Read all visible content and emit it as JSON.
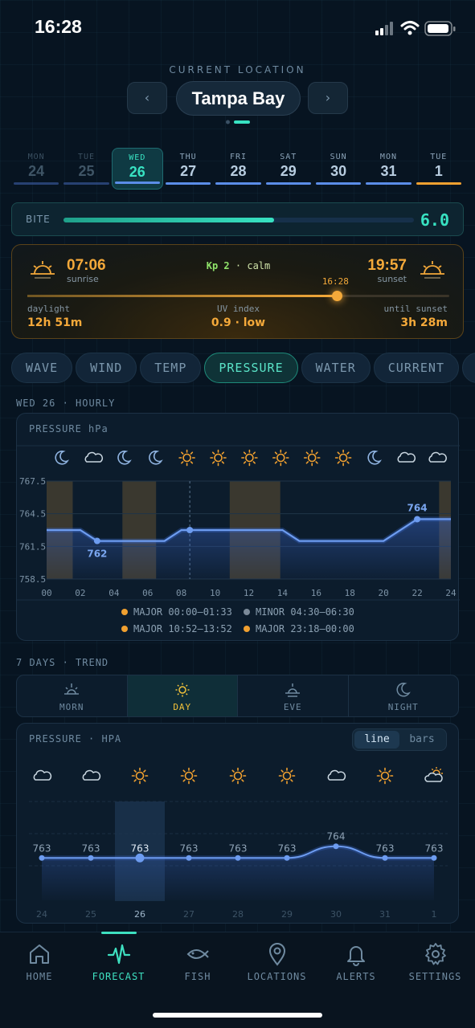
{
  "status_bar": {
    "time": "16:28"
  },
  "location": {
    "label": "CURRENT LOCATION",
    "name": "Tampa Bay",
    "prev": "‹",
    "next": "›"
  },
  "days": [
    {
      "name": "MON",
      "date": "24",
      "state": "past",
      "bar_color": "#3d5fa8"
    },
    {
      "name": "TUE",
      "date": "25",
      "state": "past",
      "bar_color": "#3d5fa8"
    },
    {
      "name": "WED",
      "date": "26",
      "state": "selected",
      "bar_color": "#5b8de8"
    },
    {
      "name": "THU",
      "date": "27",
      "state": "future",
      "bar_color": "#5b8de8"
    },
    {
      "name": "FRI",
      "date": "28",
      "state": "future",
      "bar_color": "#5b8de8"
    },
    {
      "name": "SAT",
      "date": "29",
      "state": "future",
      "bar_color": "#5b8de8"
    },
    {
      "name": "SUN",
      "date": "30",
      "state": "future",
      "bar_color": "#5b8de8"
    },
    {
      "name": "MON",
      "date": "31",
      "state": "future",
      "bar_color": "#5b8de8"
    },
    {
      "name": "TUE",
      "date": "1",
      "state": "future",
      "bar_color": "#f0a030"
    }
  ],
  "bite": {
    "label": "BITE",
    "value": "6.0",
    "level": 0.6
  },
  "sun": {
    "sunrise_time": "07:06",
    "sunrise_label": "sunrise",
    "sunset_time": "19:57",
    "sunset_label": "sunset",
    "kp_value": "Kp 2",
    "kp_sep": " · ",
    "kp_text": "calm",
    "now": "16:28",
    "progress": 0.733,
    "daylight_label": "daylight",
    "daylight_value": "12h 51m",
    "uv_label": "UV index",
    "uv_value": "0.9 · low",
    "until_label": "until sunset",
    "until_value": "3h 28m"
  },
  "tabs": [
    "WAVE",
    "WIND",
    "TEMP",
    "PRESSURE",
    "WATER",
    "CURRENT",
    "B"
  ],
  "selected_tab": "PRESSURE",
  "hourly": {
    "section_label": "WED 26 · HOURLY",
    "panel_title": "PRESSURE hPa",
    "icons": [
      "moon-icon",
      "cloud-icon",
      "moon-icon",
      "moon-icon",
      "sun-icon",
      "sun-icon",
      "sun-icon",
      "sun-icon",
      "sun-icon",
      "sun-icon",
      "moon-icon",
      "cloud-icon",
      "cloud-icon"
    ],
    "legend": [
      {
        "dot": "#f0a030",
        "kind": "MAJOR",
        "range": "00:00–01:33"
      },
      {
        "dot": "#7b8a99",
        "kind": "MINOR",
        "range": "04:30–06:30"
      },
      {
        "dot": "#f0a030",
        "kind": "MAJOR",
        "range": "10:52–13:52"
      },
      {
        "dot": "#f0a030",
        "kind": "MAJOR",
        "range": "23:18–00:00"
      }
    ]
  },
  "trend": {
    "section_label": "7 DAYS · TREND",
    "parts": [
      {
        "label": "MORN",
        "icon": "sunrise-icon"
      },
      {
        "label": "DAY",
        "icon": "sun-icon",
        "selected": true
      },
      {
        "label": "EVE",
        "icon": "sunset-icon"
      },
      {
        "label": "NIGHT",
        "icon": "moon-icon"
      }
    ],
    "panel_title": "PRESSURE · HPA",
    "toggle": {
      "line": "line",
      "bars": "bars"
    },
    "icons": [
      "cloud-icon",
      "cloud-icon",
      "sun-icon",
      "sun-icon",
      "sun-icon",
      "sun-icon",
      "cloud-icon",
      "sun-icon",
      "partly-sunny-icon"
    ]
  },
  "chart_data": [
    {
      "type": "line",
      "ylim": [
        758.5,
        767.5
      ],
      "yticks": [
        "767.5",
        "764.5",
        "761.5",
        "758.5"
      ],
      "xticks": [
        "00",
        "02",
        "04",
        "06",
        "08",
        "10",
        "12",
        "14",
        "16",
        "18",
        "20",
        "22",
        "24"
      ],
      "x": [
        0,
        2,
        3,
        7,
        8,
        14,
        15,
        20,
        22,
        24
      ],
      "values": [
        763.0,
        763.0,
        762.0,
        762.0,
        763.0,
        763.0,
        762.0,
        762.0,
        764.0,
        764.0
      ],
      "annotations": [
        {
          "x": 3,
          "label": "762"
        },
        {
          "x": 22,
          "label": "764"
        }
      ],
      "now_x": 8.5,
      "bands": [
        {
          "from": 0,
          "to": 1.55
        },
        {
          "from": 4.5,
          "to": 6.5
        },
        {
          "from": 10.87,
          "to": 13.87
        },
        {
          "from": 23.3,
          "to": 24
        }
      ]
    },
    {
      "type": "line",
      "categories": [
        "24",
        "25",
        "26",
        "27",
        "28",
        "29",
        "30",
        "31",
        "1"
      ],
      "values": [
        763,
        763,
        763,
        763,
        763,
        763,
        764,
        763,
        763
      ],
      "labels": [
        "763",
        "763",
        "763",
        "763",
        "763",
        "763",
        "764",
        "763",
        "763"
      ],
      "selected_index": 2
    }
  ],
  "nav": [
    {
      "label": "HOME",
      "icon": "home-icon"
    },
    {
      "label": "FORECAST",
      "icon": "pulse-icon",
      "selected": true
    },
    {
      "label": "FISH",
      "icon": "fish-icon"
    },
    {
      "label": "LOCATIONS",
      "icon": "location-pin-icon"
    },
    {
      "label": "ALERTS",
      "icon": "bell-icon"
    },
    {
      "label": "SETTINGS",
      "icon": "gear-icon"
    }
  ],
  "colors": {
    "accent": "#38e2c2",
    "sun": "#f4a93a",
    "line": "#5b8de8"
  }
}
